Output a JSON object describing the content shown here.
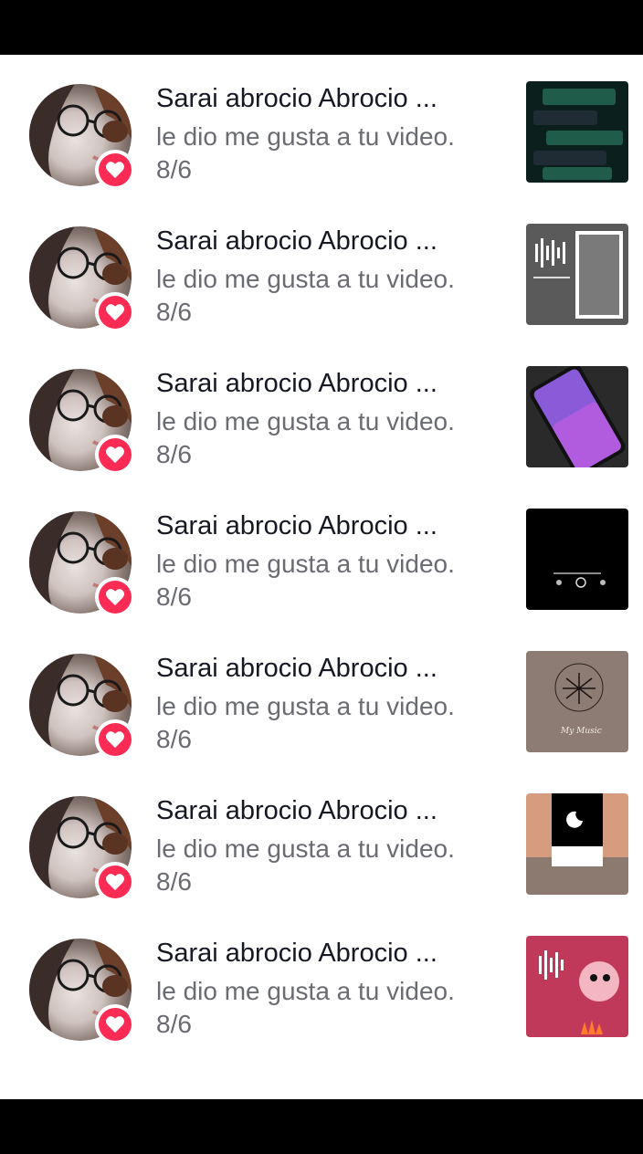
{
  "notifications": [
    {
      "name": "Sarai abrocio Abrocio ...",
      "action": "le dio me gusta a tu video.",
      "date": "8/6",
      "thumb": "whatsapp-chat-thumbnail",
      "thumb_text": []
    },
    {
      "name": "Sarai abrocio Abrocio ...",
      "action": "le dio me gusta a tu video.",
      "date": "8/6",
      "thumb": "audio-frame-thumbnail",
      "thumb_text": []
    },
    {
      "name": "Sarai abrocio Abrocio ...",
      "action": "le dio me gusta a tu video.",
      "date": "8/6",
      "thumb": "phone-gradient-thumbnail",
      "thumb_text": []
    },
    {
      "name": "Sarai abrocio Abrocio ...",
      "action": "le dio me gusta a tu video.",
      "date": "8/6",
      "thumb": "dark-player-thumbnail",
      "thumb_text": []
    },
    {
      "name": "Sarai abrocio Abrocio ...",
      "action": "le dio me gusta a tu video.",
      "date": "8/6",
      "thumb": "my-music-thumbnail",
      "thumb_text": [
        "My Music"
      ]
    },
    {
      "name": "Sarai abrocio Abrocio ...",
      "action": "le dio me gusta a tu video.",
      "date": "8/6",
      "thumb": "moon-sunset-thumbnail",
      "thumb_text": []
    },
    {
      "name": "Sarai abrocio Abrocio ...",
      "action": "le dio me gusta a tu video.",
      "date": "8/6",
      "thumb": "pink-collage-thumbnail",
      "thumb_text": []
    }
  ],
  "colors": {
    "like_badge": "#fe2c55",
    "name_text": "#161823",
    "secondary_text": "#6b6c73"
  },
  "icons": {
    "badge": "heart-icon"
  }
}
